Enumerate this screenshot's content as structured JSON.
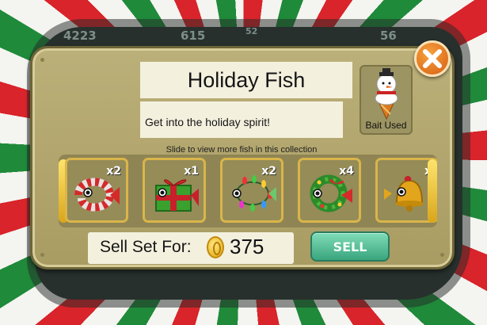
{
  "hud": {
    "stat_1": "4223",
    "stat_2": "615",
    "stat_3": "52",
    "stat_4": "56"
  },
  "dialog": {
    "title": "Holiday Fish",
    "description": "Get into the holiday spirit!",
    "bait_label": "Bait Used",
    "bait_icon": "snowman-cone-icon",
    "close_icon": "close-x-icon",
    "carousel_hint": "Slide to view more fish in this collection"
  },
  "fish": [
    {
      "name": "candy-cane-fish",
      "count": "x2"
    },
    {
      "name": "gift-box-fish",
      "count": "x1"
    },
    {
      "name": "string-lights-fish",
      "count": "x2"
    },
    {
      "name": "wreath-fish",
      "count": "x4"
    },
    {
      "name": "bell-fish",
      "count": "x"
    }
  ],
  "sell": {
    "label": "Sell Set For:",
    "price": "375",
    "button": "SELL",
    "coin_icon": "gold-coin-icon"
  },
  "colors": {
    "panel": "#b5a970",
    "sell_button": "#4fbf96",
    "close_button": "#e97a25",
    "highlight": "#d9b54a"
  }
}
